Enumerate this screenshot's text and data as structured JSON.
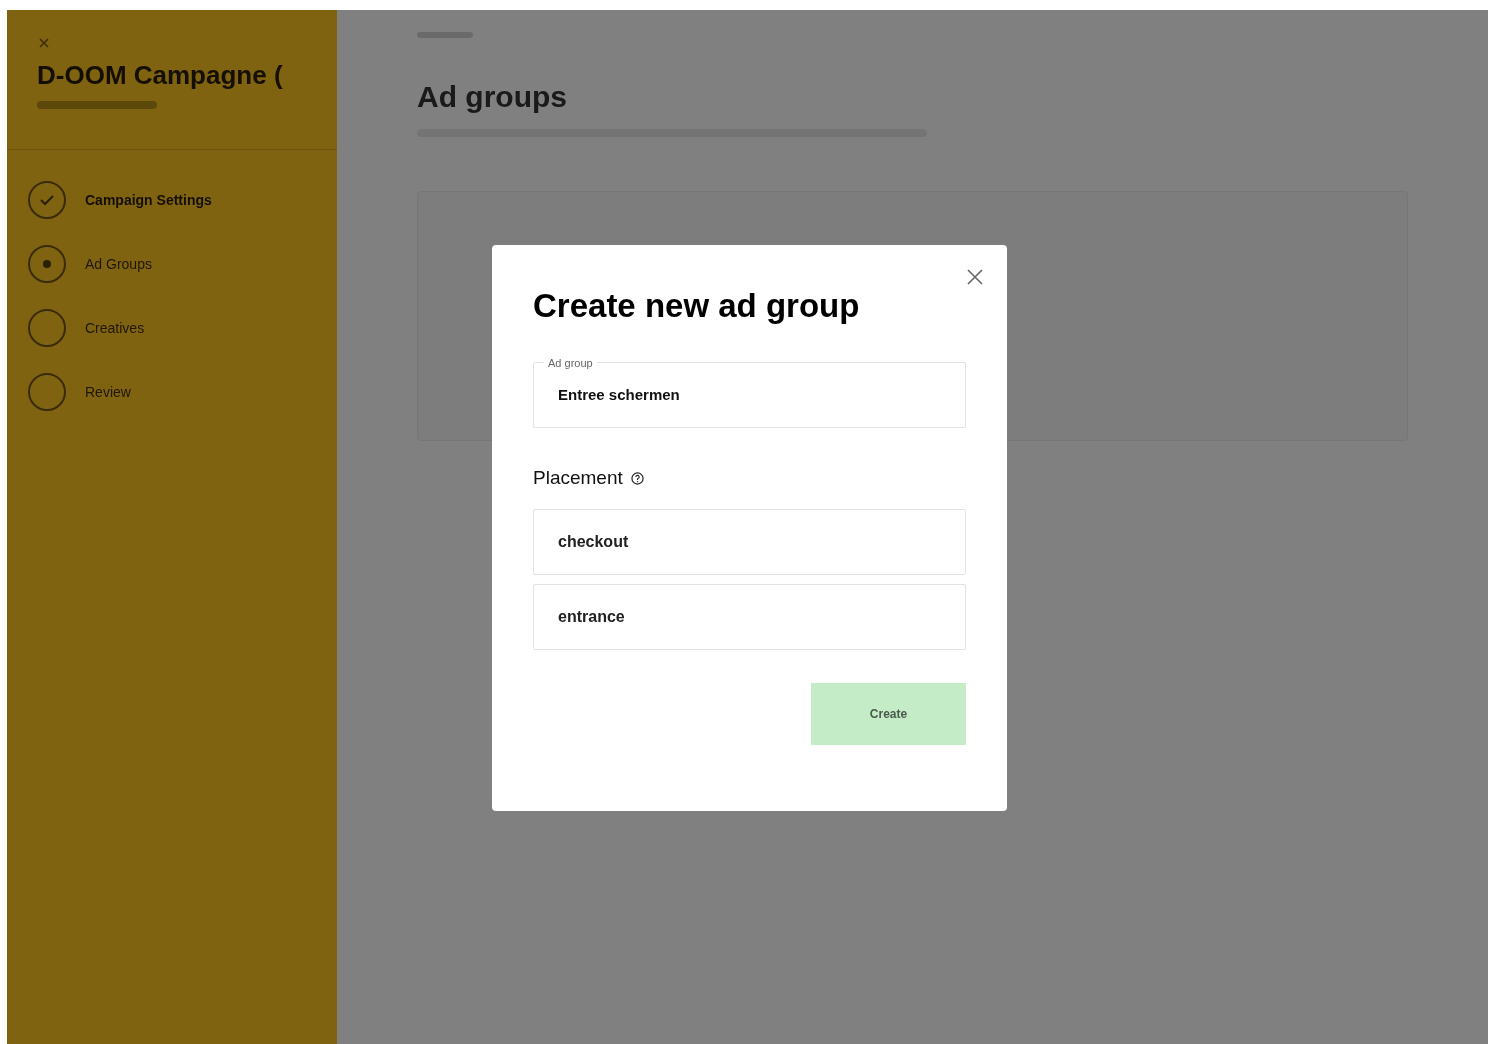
{
  "sidebar": {
    "title": "D-OOM Campagne (",
    "steps": [
      {
        "label": "Campaign Settings",
        "kind": "done"
      },
      {
        "label": "Ad Groups",
        "kind": "current"
      },
      {
        "label": "Creatives",
        "kind": "pending"
      },
      {
        "label": "Review",
        "kind": "pending"
      }
    ]
  },
  "main": {
    "title": "Ad groups"
  },
  "dialog": {
    "title": "Create new ad group",
    "field": {
      "label": "Ad group",
      "value": "Entree schermen"
    },
    "placement": {
      "label": "Placement",
      "options": [
        {
          "label": "checkout"
        },
        {
          "label": "entrance"
        }
      ]
    },
    "button": {
      "label": "Create",
      "disabled": true
    }
  }
}
